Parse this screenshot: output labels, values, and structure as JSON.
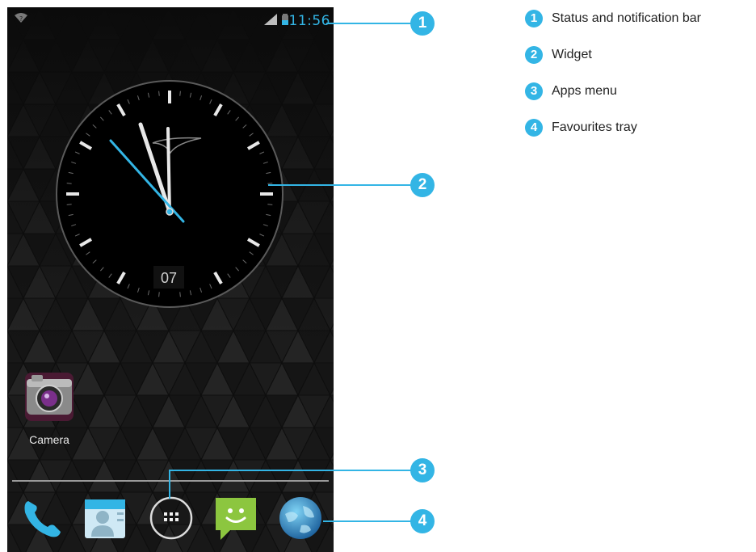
{
  "status_bar": {
    "time": "11:56",
    "icons": [
      "wifi-icon",
      "signal-icon",
      "battery-icon"
    ]
  },
  "clock_widget": {
    "date": "07"
  },
  "home_apps": [
    {
      "label": "Camera",
      "icon": "camera-icon"
    }
  ],
  "dock": {
    "items": [
      "phone-icon",
      "contacts-icon",
      "apps-menu-icon",
      "messaging-icon",
      "browser-icon"
    ]
  },
  "callouts": [
    "1",
    "2",
    "3",
    "4"
  ],
  "legend": [
    {
      "num": "1",
      "label": "Status and notification bar"
    },
    {
      "num": "2",
      "label": "Widget"
    },
    {
      "num": "3",
      "label": "Apps menu"
    },
    {
      "num": "4",
      "label": "Favourites tray"
    }
  ],
  "colors": {
    "accent": "#33b5e5",
    "screen_bg": "#0b0b0b"
  }
}
